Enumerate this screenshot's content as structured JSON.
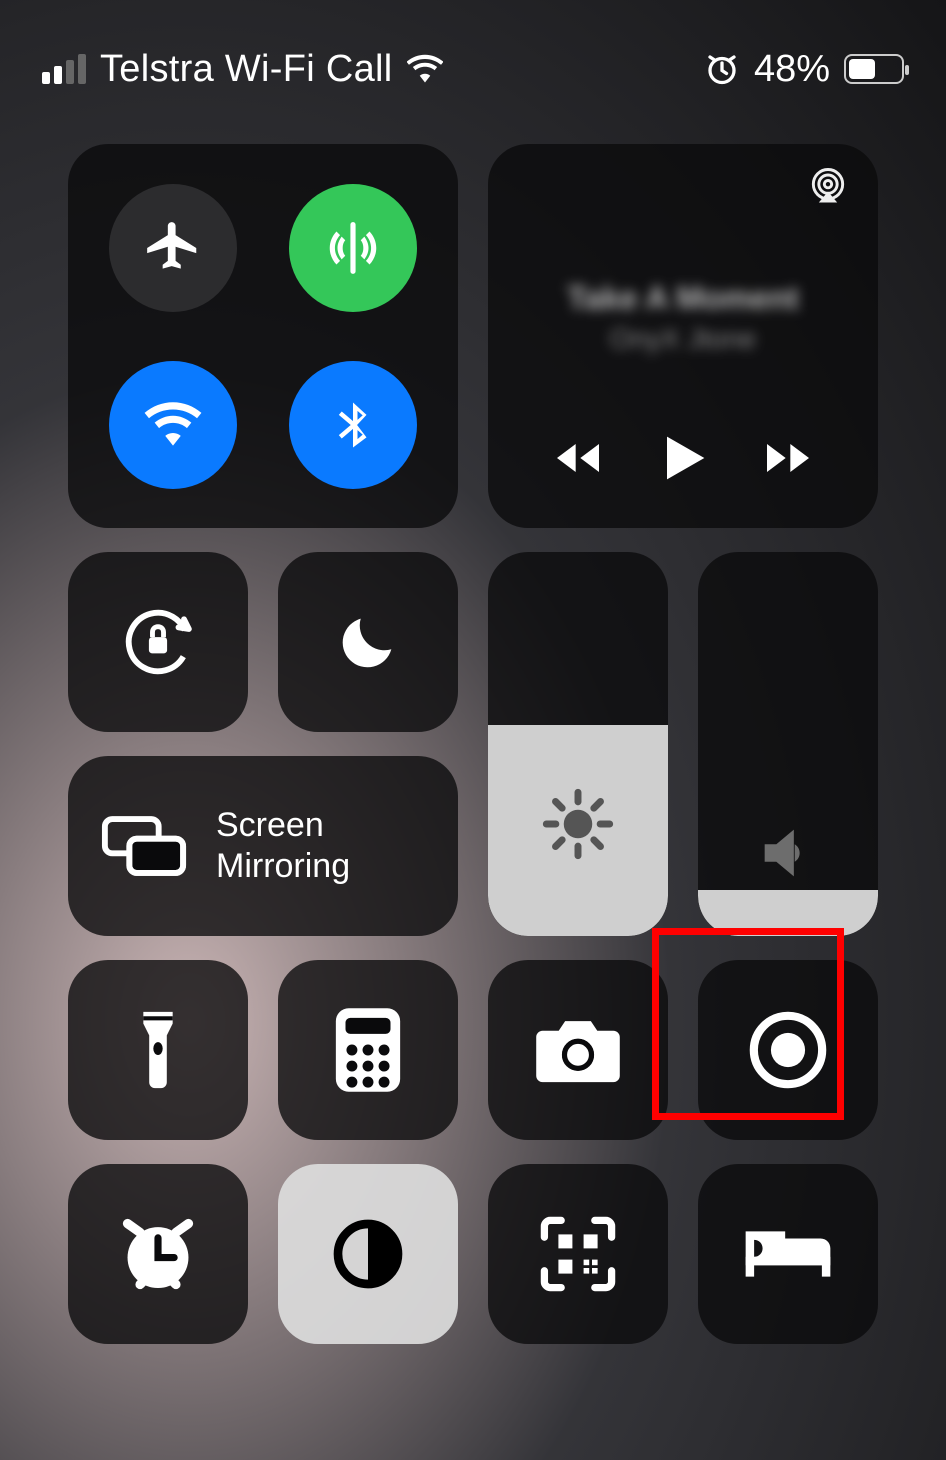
{
  "status": {
    "carrier": "Telstra Wi-Fi Call",
    "signal_bars_active": 2,
    "signal_bars_total": 4,
    "wifi_connected": true,
    "alarm_set": true,
    "battery_percent_label": "48%",
    "battery_percent": 48
  },
  "connectivity": {
    "airplane": {
      "on": false
    },
    "cellular": {
      "on": true
    },
    "wifi": {
      "on": true
    },
    "bluetooth": {
      "on": true
    }
  },
  "media": {
    "title": "Take A Moment",
    "artist": "OnyX Jtone",
    "playing": false
  },
  "screen_mirroring": {
    "label": "Screen\nMirroring"
  },
  "brightness": {
    "level_pct": 55
  },
  "volume": {
    "level_pct": 12
  },
  "shortcuts": {
    "row1": [
      "orientation-lock",
      "do-not-disturb"
    ],
    "row2": [
      "flashlight",
      "calculator",
      "camera",
      "screen-record"
    ],
    "row3": [
      "alarm",
      "dark-mode",
      "qr-scanner",
      "sleep"
    ]
  },
  "highlighted": "screen-record"
}
